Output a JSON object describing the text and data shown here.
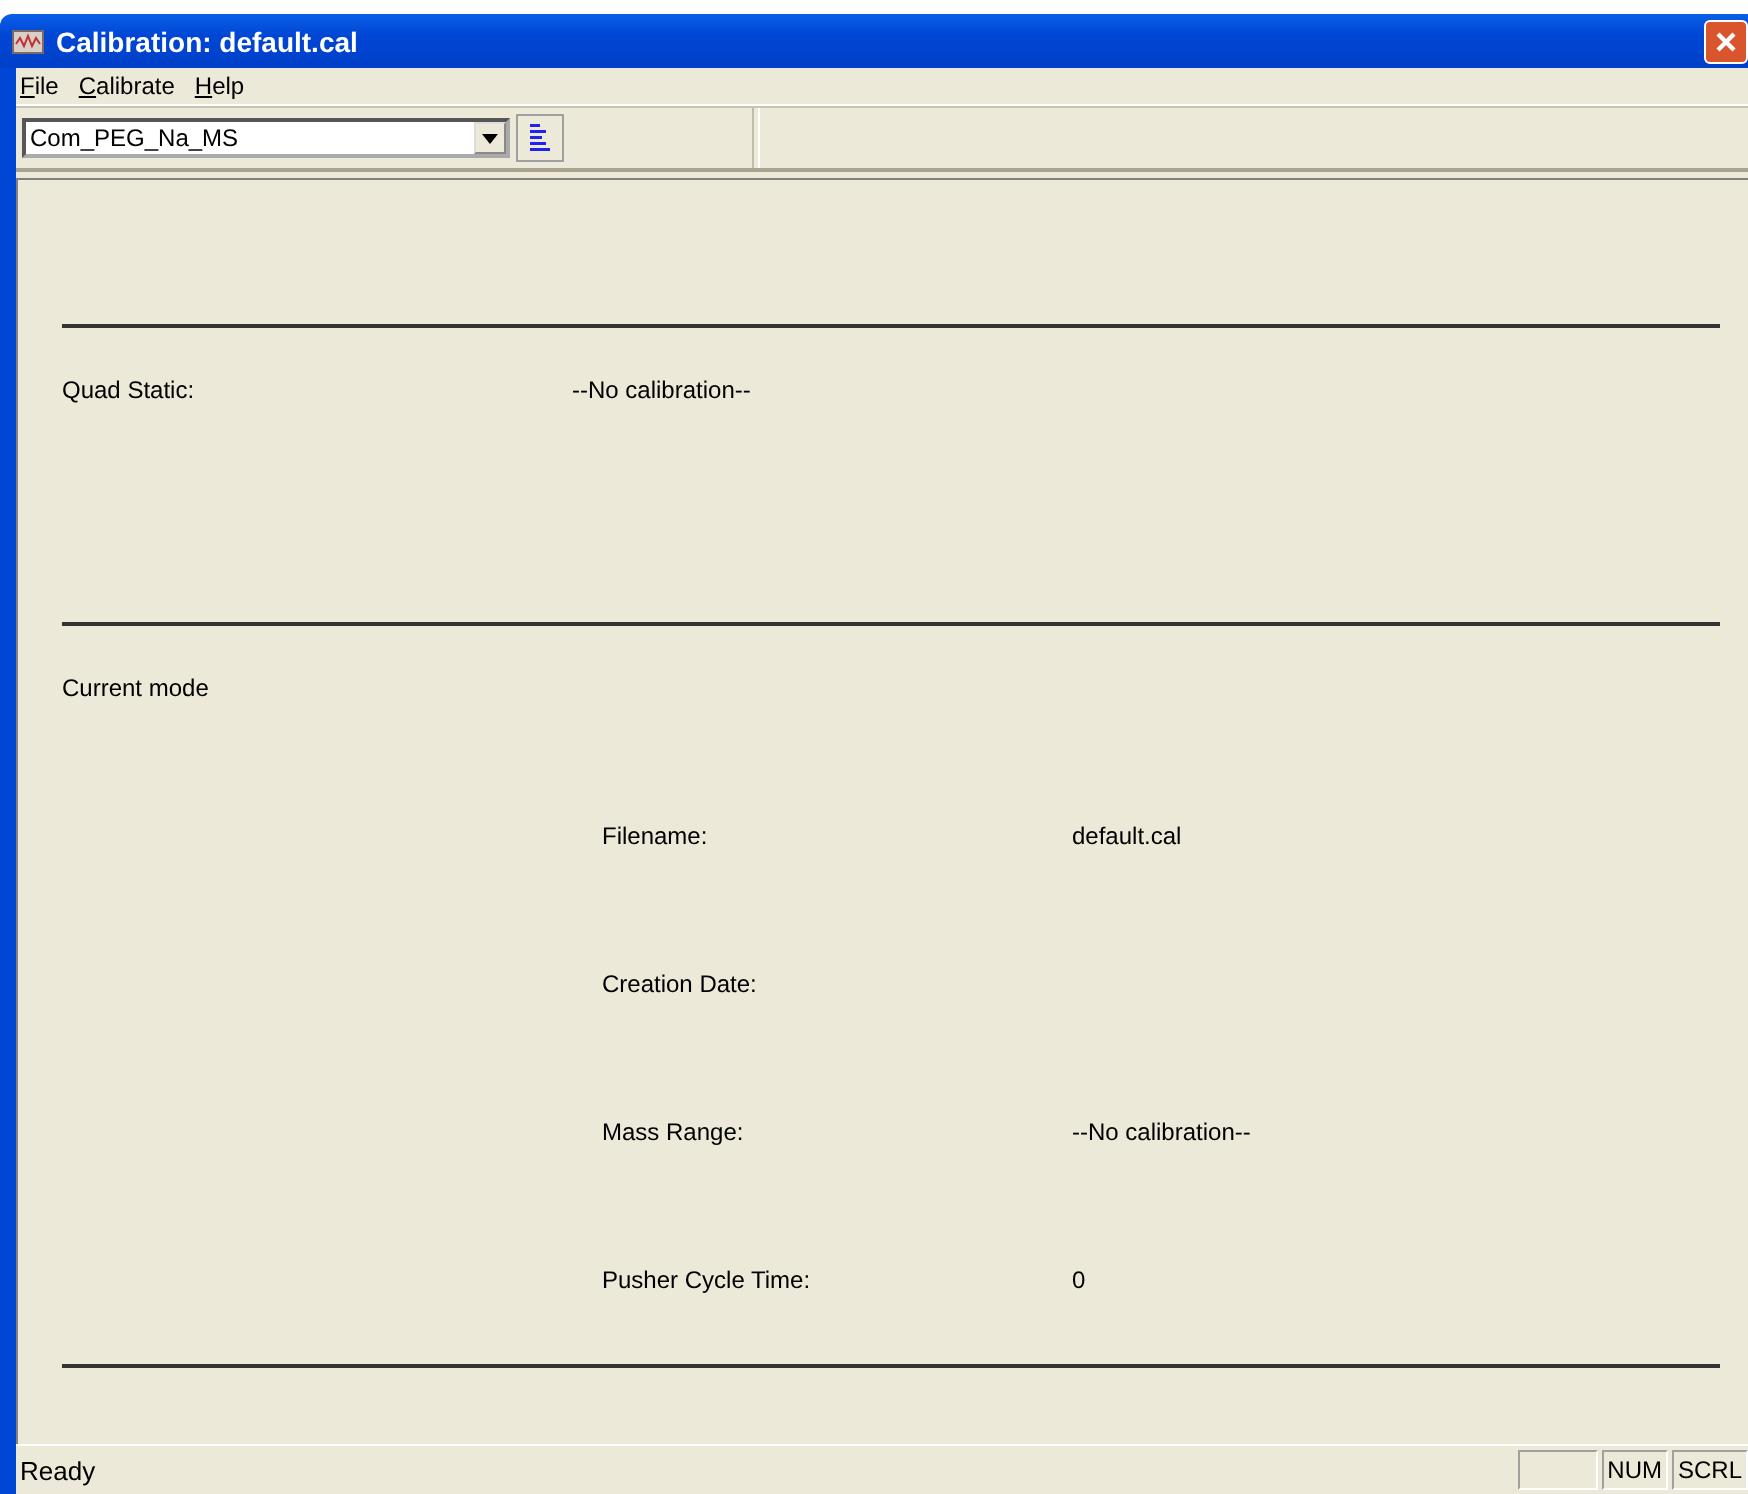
{
  "window": {
    "title": "Calibration: default.cal"
  },
  "menu": [
    "File",
    "Calibrate",
    "Help"
  ],
  "toolbar": {
    "combo_value": "Com_PEG_Na_MS"
  },
  "sections": [
    {
      "label": "Quad Static:",
      "value": "--No calibration--"
    },
    {
      "label": "Current mode",
      "fields": [
        {
          "label": "Filename:",
          "value": "default.cal"
        },
        {
          "label": "Creation Date:"
        },
        {
          "label": "Mass Range:",
          "value": "--No calibration--"
        },
        {
          "label": "Pusher Cycle Time:",
          "value": "0"
        }
      ]
    }
  ],
  "status_bar": {
    "text": "Ready",
    "indicators": [
      "NUM",
      "SCRL"
    ]
  }
}
